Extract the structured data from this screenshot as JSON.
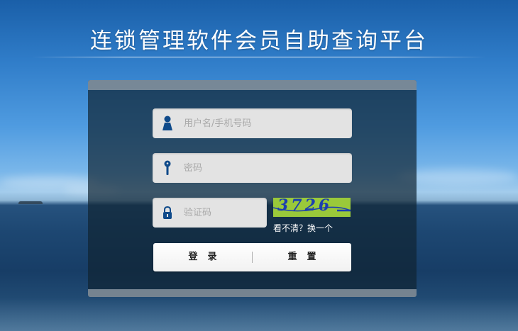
{
  "page": {
    "title": "连锁管理软件会员自助查询平台"
  },
  "login": {
    "username_placeholder": "用户名/手机号码",
    "password_placeholder": "密码",
    "captcha_placeholder": "验证码",
    "captcha_text": "3726",
    "refresh_label": "看不清？换一个",
    "login_label": "登录",
    "reset_label": "重置"
  },
  "icons": {
    "username": "user-icon",
    "password": "key-icon",
    "captcha": "lock-icon"
  },
  "colors": {
    "icon_blue": "#0f4a8a",
    "captcha_bg": "#9ac93a",
    "captcha_fg": "#1c3fb0"
  }
}
